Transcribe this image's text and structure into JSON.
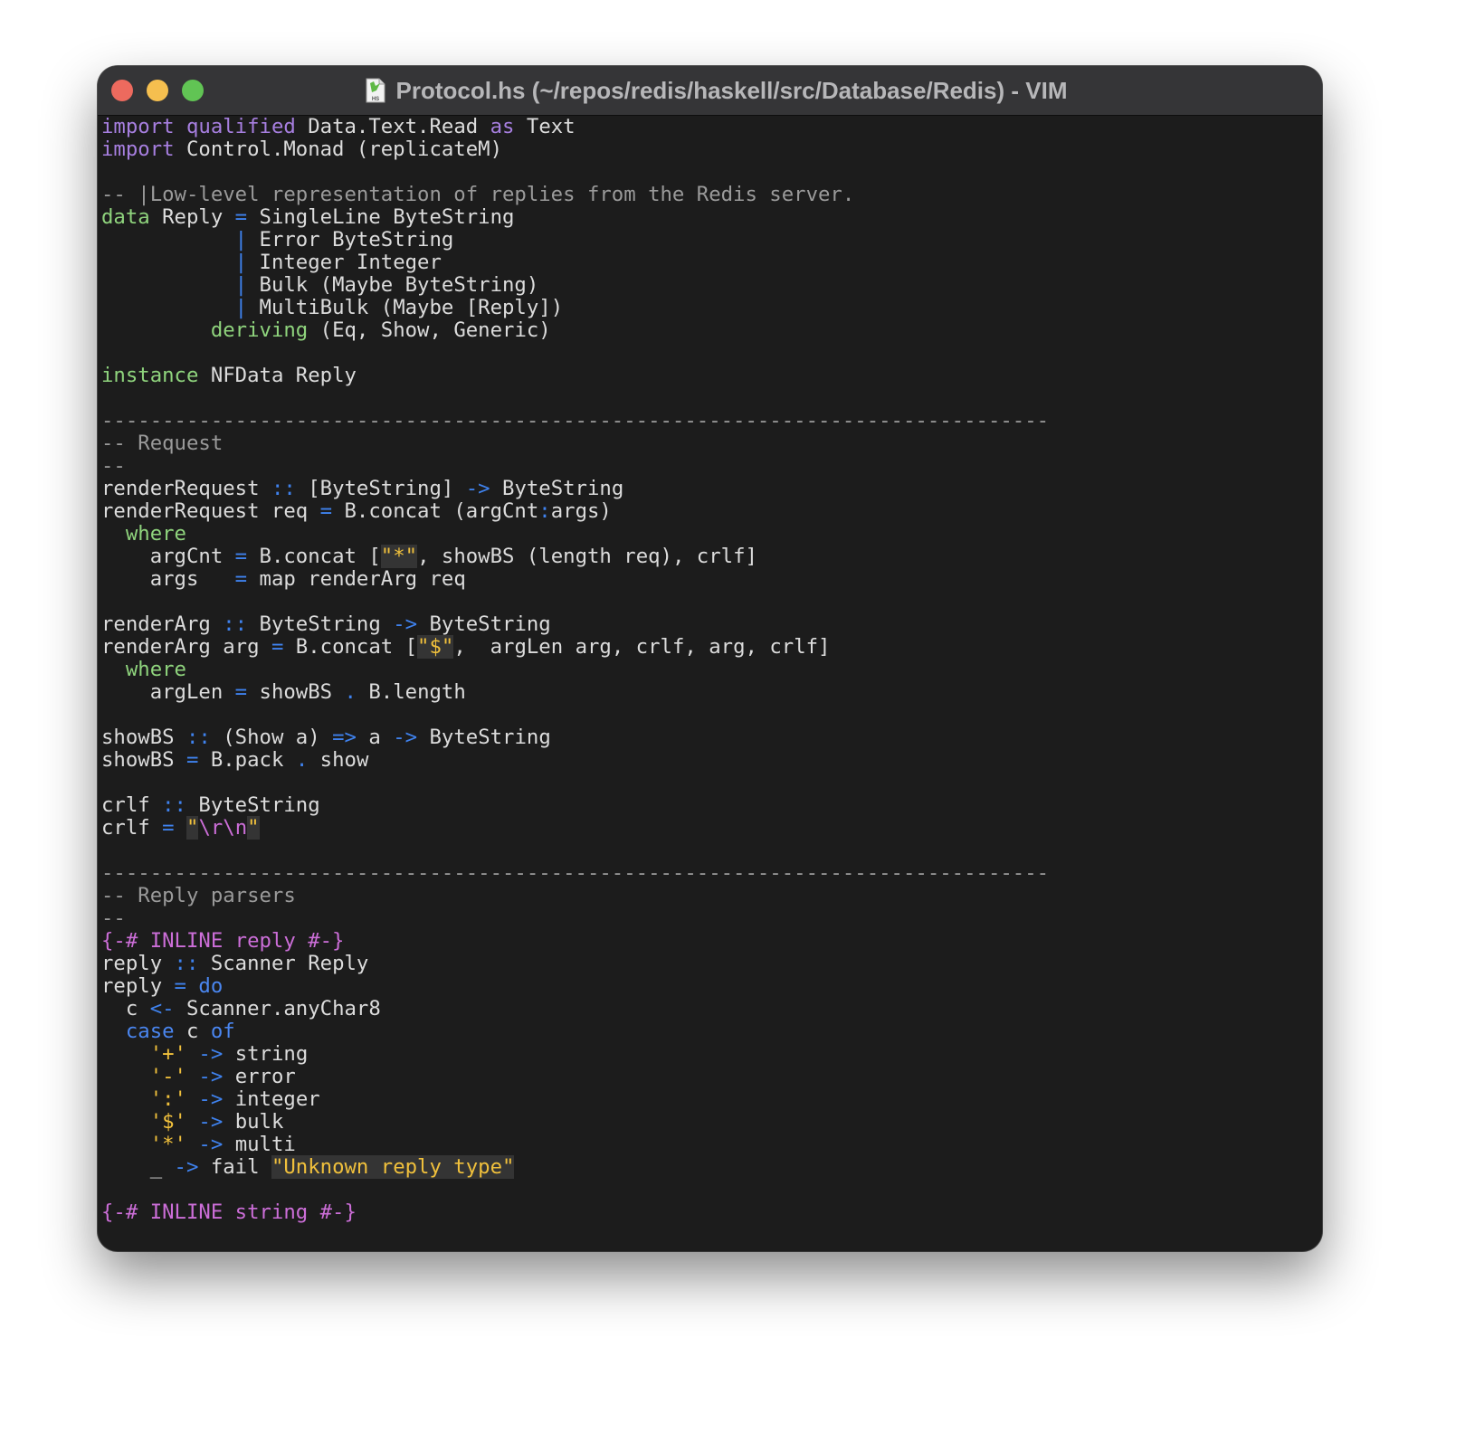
{
  "window": {
    "title": "Protocol.hs (~/repos/redis/haskell/src/Database/Redis) - VIM",
    "file_icon": "haskell-file-icon",
    "file_icon_label": "HS",
    "traffic_lights": {
      "close": "#ed6a5e",
      "minimize": "#f5bf4f",
      "maximize": "#61c454"
    }
  },
  "editor": {
    "lines": [
      [
        {
          "t": "import",
          "c": "kw-import"
        },
        {
          "t": " "
        },
        {
          "t": "qualified",
          "c": "kw-import"
        },
        {
          "t": " Data.Text.Read "
        },
        {
          "t": "as",
          "c": "kw-import"
        },
        {
          "t": " Text"
        }
      ],
      [
        {
          "t": "import",
          "c": "kw-import"
        },
        {
          "t": " Control.Monad (replicateM)"
        }
      ],
      [],
      [
        {
          "t": "-- |Low-level representation of replies from the Redis server.",
          "c": "comment"
        }
      ],
      [
        {
          "t": "data",
          "c": "kw-green"
        },
        {
          "t": " Reply "
        },
        {
          "t": "=",
          "c": "op"
        },
        {
          "t": " SingleLine ByteString"
        }
      ],
      [
        {
          "t": "           "
        },
        {
          "t": "|",
          "c": "op"
        },
        {
          "t": " Error ByteString"
        }
      ],
      [
        {
          "t": "           "
        },
        {
          "t": "|",
          "c": "op"
        },
        {
          "t": " Integer Integer"
        }
      ],
      [
        {
          "t": "           "
        },
        {
          "t": "|",
          "c": "op"
        },
        {
          "t": " Bulk (Maybe ByteString)"
        }
      ],
      [
        {
          "t": "           "
        },
        {
          "t": "|",
          "c": "op"
        },
        {
          "t": " MultiBulk (Maybe [Reply])"
        }
      ],
      [
        {
          "t": "         "
        },
        {
          "t": "deriving",
          "c": "kw-green"
        },
        {
          "t": " (Eq, Show, Generic)"
        }
      ],
      [],
      [
        {
          "t": "instance",
          "c": "kw-green"
        },
        {
          "t": " NFData Reply"
        }
      ],
      [],
      [
        {
          "t": "------------------------------------------------------------------------------",
          "c": "comment"
        }
      ],
      [
        {
          "t": "-- Request",
          "c": "comment"
        }
      ],
      [
        {
          "t": "--",
          "c": "comment"
        }
      ],
      [
        {
          "t": "renderRequest "
        },
        {
          "t": "::",
          "c": "op"
        },
        {
          "t": " [ByteString] "
        },
        {
          "t": "->",
          "c": "op"
        },
        {
          "t": " ByteString"
        }
      ],
      [
        {
          "t": "renderRequest req "
        },
        {
          "t": "=",
          "c": "op"
        },
        {
          "t": " B.concat (argCnt"
        },
        {
          "t": ":",
          "c": "op"
        },
        {
          "t": "args)"
        }
      ],
      [
        {
          "t": "  "
        },
        {
          "t": "where",
          "c": "kw-green"
        }
      ],
      [
        {
          "t": "    argCnt "
        },
        {
          "t": "=",
          "c": "op"
        },
        {
          "t": " B.concat ["
        },
        {
          "t": "\"*\"",
          "c": "str hl"
        },
        {
          "t": ", showBS (length req), crlf]"
        }
      ],
      [
        {
          "t": "    args   "
        },
        {
          "t": "=",
          "c": "op"
        },
        {
          "t": " map renderArg req"
        }
      ],
      [],
      [
        {
          "t": "renderArg "
        },
        {
          "t": "::",
          "c": "op"
        },
        {
          "t": " ByteString "
        },
        {
          "t": "->",
          "c": "op"
        },
        {
          "t": " ByteString"
        }
      ],
      [
        {
          "t": "renderArg arg "
        },
        {
          "t": "=",
          "c": "op"
        },
        {
          "t": " B.concat ["
        },
        {
          "t": "\"$\"",
          "c": "str hl"
        },
        {
          "t": ",  argLen arg, crlf, arg, crlf]"
        }
      ],
      [
        {
          "t": "  "
        },
        {
          "t": "where",
          "c": "kw-green"
        }
      ],
      [
        {
          "t": "    argLen "
        },
        {
          "t": "=",
          "c": "op"
        },
        {
          "t": " showBS "
        },
        {
          "t": ".",
          "c": "op"
        },
        {
          "t": " B.length"
        }
      ],
      [],
      [
        {
          "t": "showBS "
        },
        {
          "t": "::",
          "c": "op"
        },
        {
          "t": " (Show a) "
        },
        {
          "t": "=>",
          "c": "op"
        },
        {
          "t": " a "
        },
        {
          "t": "->",
          "c": "op"
        },
        {
          "t": " ByteString"
        }
      ],
      [
        {
          "t": "showBS "
        },
        {
          "t": "=",
          "c": "op"
        },
        {
          "t": " B.pack "
        },
        {
          "t": ".",
          "c": "op"
        },
        {
          "t": " show"
        }
      ],
      [],
      [
        {
          "t": "crlf "
        },
        {
          "t": "::",
          "c": "op"
        },
        {
          "t": " ByteString"
        }
      ],
      [
        {
          "t": "crlf "
        },
        {
          "t": "=",
          "c": "op"
        },
        {
          "t": " "
        },
        {
          "t": "\"",
          "c": "str hl"
        },
        {
          "t": "\\r\\n",
          "c": "esc"
        },
        {
          "t": "\"",
          "c": "str hl"
        }
      ],
      [],
      [
        {
          "t": "------------------------------------------------------------------------------",
          "c": "comment"
        }
      ],
      [
        {
          "t": "-- Reply parsers",
          "c": "comment"
        }
      ],
      [
        {
          "t": "--",
          "c": "comment"
        }
      ],
      [
        {
          "t": "{-# INLINE reply #-}",
          "c": "pragma"
        }
      ],
      [
        {
          "t": "reply "
        },
        {
          "t": "::",
          "c": "op"
        },
        {
          "t": " Scanner Reply"
        }
      ],
      [
        {
          "t": "reply "
        },
        {
          "t": "=",
          "c": "op"
        },
        {
          "t": " "
        },
        {
          "t": "do",
          "c": "kw-blue"
        }
      ],
      [
        {
          "t": "  c "
        },
        {
          "t": "<-",
          "c": "op"
        },
        {
          "t": " Scanner.anyChar8"
        }
      ],
      [
        {
          "t": "  "
        },
        {
          "t": "case",
          "c": "kw-blue"
        },
        {
          "t": " c "
        },
        {
          "t": "of",
          "c": "kw-blue"
        }
      ],
      [
        {
          "t": "    "
        },
        {
          "t": "'+'",
          "c": "str"
        },
        {
          "t": " "
        },
        {
          "t": "->",
          "c": "op"
        },
        {
          "t": " string"
        }
      ],
      [
        {
          "t": "    "
        },
        {
          "t": "'-'",
          "c": "str"
        },
        {
          "t": " "
        },
        {
          "t": "->",
          "c": "op"
        },
        {
          "t": " error"
        }
      ],
      [
        {
          "t": "    "
        },
        {
          "t": "':'",
          "c": "str"
        },
        {
          "t": " "
        },
        {
          "t": "->",
          "c": "op"
        },
        {
          "t": " integer"
        }
      ],
      [
        {
          "t": "    "
        },
        {
          "t": "'$'",
          "c": "str"
        },
        {
          "t": " "
        },
        {
          "t": "->",
          "c": "op"
        },
        {
          "t": " bulk"
        }
      ],
      [
        {
          "t": "    "
        },
        {
          "t": "'*'",
          "c": "str"
        },
        {
          "t": " "
        },
        {
          "t": "->",
          "c": "op"
        },
        {
          "t": " multi"
        }
      ],
      [
        {
          "t": "    _ "
        },
        {
          "t": "->",
          "c": "op"
        },
        {
          "t": " fail "
        },
        {
          "t": "\"Unknown reply type\"",
          "c": "str hl"
        }
      ],
      [],
      [
        {
          "t": "{-# INLINE string #-}",
          "c": "pragma"
        }
      ]
    ]
  }
}
